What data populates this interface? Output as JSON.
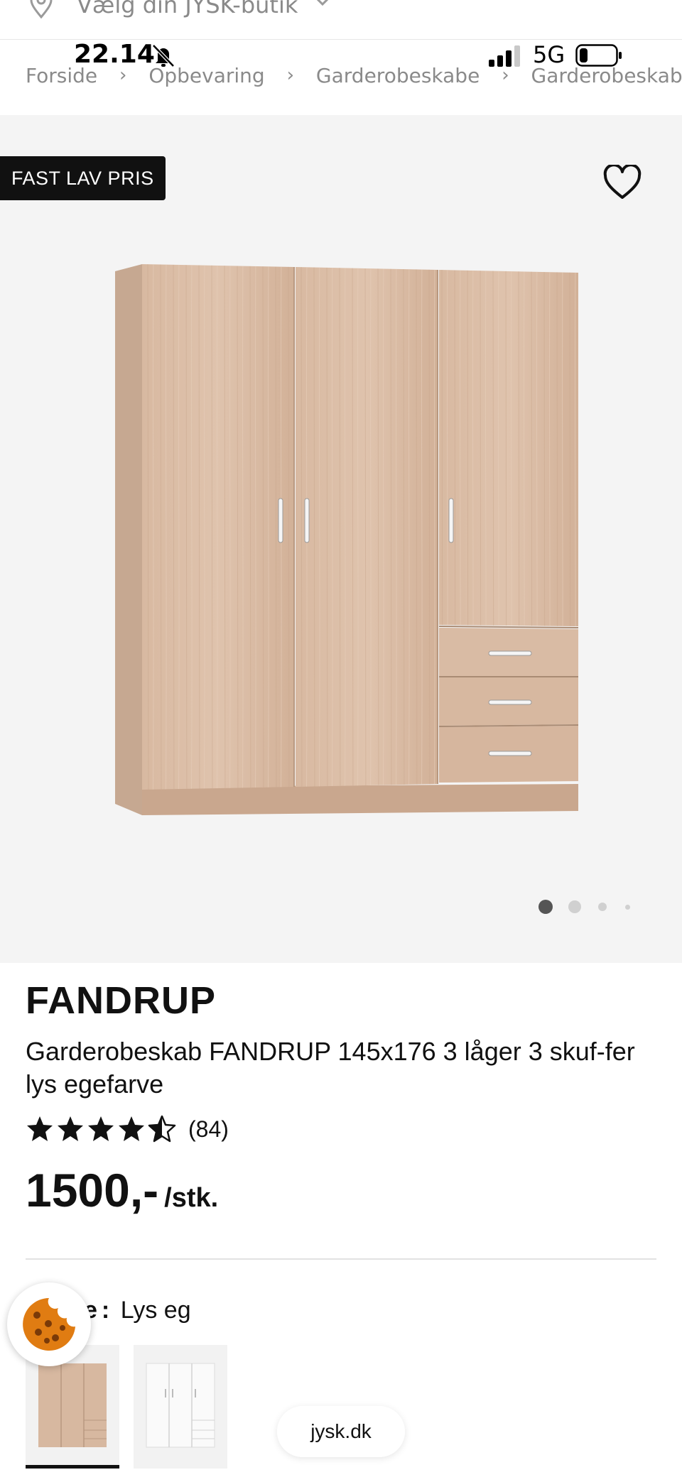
{
  "store_bar": {
    "label": "Vælg din JYSK-butik"
  },
  "status_bar": {
    "time": "22.14",
    "network": "5G"
  },
  "breadcrumb": [
    "Forside",
    "Opbevaring",
    "Garderobeskabe",
    "Garderobeskab FANDRUP"
  ],
  "gallery": {
    "badge": "FAST LAV PRIS",
    "dots_total": 4,
    "dots_active": 1
  },
  "product": {
    "brand": "FANDRUP",
    "description": "Garderobeskab FANDRUP 145x176 3 låger 3 skuf-fer lys egefarve",
    "rating_value": 4.5,
    "rating_max": 5,
    "review_count": "(84)",
    "price": "1500,-",
    "unit": "/stk."
  },
  "color_option": {
    "label": "Farve",
    "label_visible": "e",
    "value": "Lys eg"
  },
  "swatches": [
    {
      "name": "Lys eg",
      "selected": true
    },
    {
      "name": "Hvid",
      "selected": false
    }
  ],
  "browser": {
    "url": "jysk.dk"
  },
  "colors": {
    "wood": "#d7b8a0",
    "wood_dark": "#c29f86",
    "badge_bg": "#111111",
    "gallery_bg": "#f4f4f4"
  },
  "icons": {
    "location": "location-pin-icon",
    "chevron": "chevron-down-icon",
    "favorite": "heart-icon",
    "star": "star-icon",
    "cookie": "cookie-icon",
    "bell": "bell-slash-icon"
  }
}
